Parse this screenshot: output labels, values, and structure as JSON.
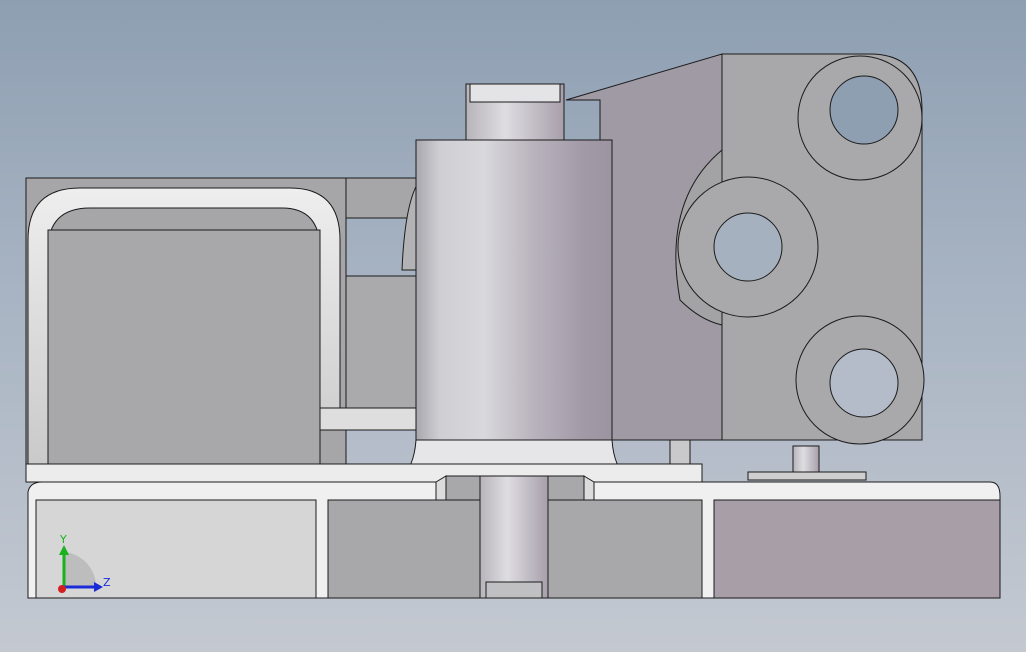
{
  "viewport": {
    "background_top": "#8e9fb2",
    "background_bottom": "#c4c9d1",
    "part_color": "#a9a9ab",
    "edge_color": "#1b1b1b"
  },
  "triad": {
    "y_label": "Y",
    "z_label": "Z",
    "y_color": "#19b21c",
    "z_color": "#1a2bd8",
    "origin_color": "#d21f1f"
  }
}
